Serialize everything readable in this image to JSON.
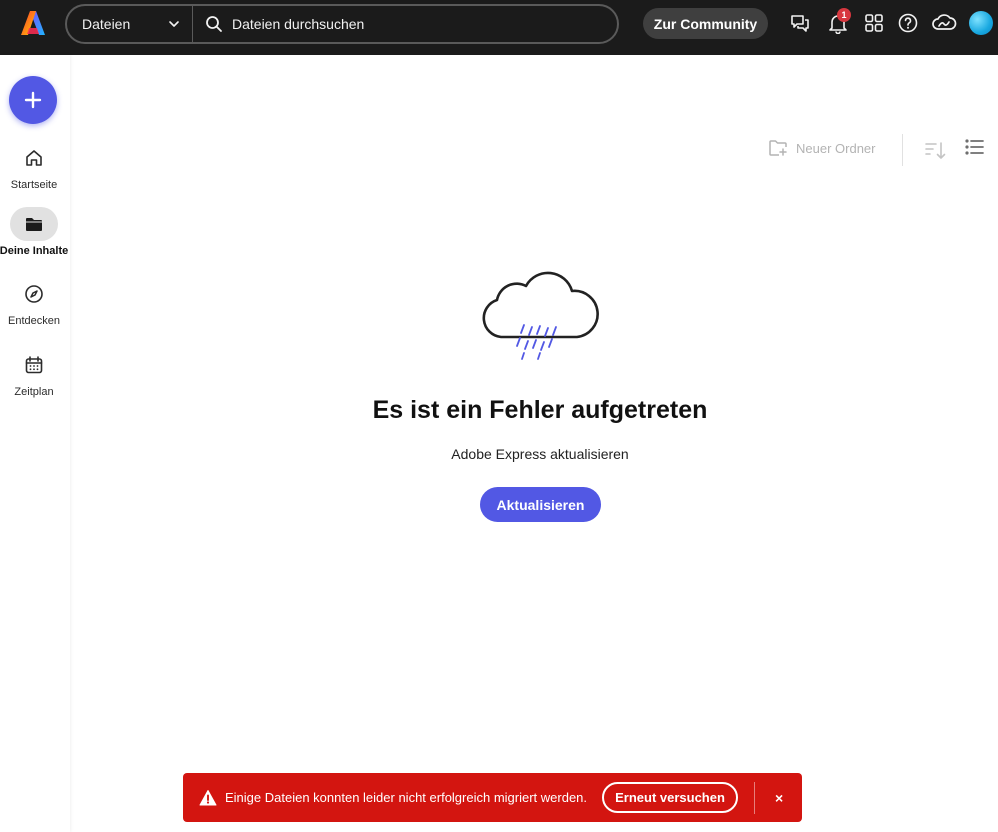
{
  "header": {
    "scope_label": "Dateien",
    "search_placeholder": "Dateien durchsuchen",
    "community_button": "Zur Community",
    "notification_count": "1",
    "icons": [
      "adobe-express-logo",
      "chevron-down-icon",
      "search-icon",
      "chat-icon",
      "bell-icon",
      "apps-grid-icon",
      "help-icon",
      "creative-cloud-icon",
      "avatar"
    ]
  },
  "sidebar": {
    "create_icon": "plus-icon",
    "items": [
      {
        "label": "Startseite",
        "icon": "home-icon"
      },
      {
        "label": "Deine Inhalte",
        "icon": "folder-icon",
        "active": true
      },
      {
        "label": "Entdecken",
        "icon": "compass-icon"
      },
      {
        "label": "Zeitplan",
        "icon": "calendar-icon"
      }
    ]
  },
  "toolbar": {
    "new_folder_label": "Neuer Ordner",
    "icons": [
      "new-folder-icon",
      "sort-icon",
      "list-view-icon"
    ]
  },
  "main": {
    "error_title": "Es ist ein Fehler aufgetreten",
    "error_subtitle": "Adobe Express aktualisieren",
    "refresh_button": "Aktualisieren",
    "illustration": "rain-cloud-icon"
  },
  "toast": {
    "message": "Einige Dateien konnten leider nicht erfolgreich migriert werden.",
    "retry_button": "Erneut versuchen",
    "close_symbol": "×",
    "icon": "alert-triangle-icon"
  },
  "colors": {
    "topbar_bg": "#1b1b1b",
    "accent": "#5258e4",
    "toast_bg": "#d31510",
    "notification_badge": "#d7373f",
    "rain": "#5258e4"
  }
}
